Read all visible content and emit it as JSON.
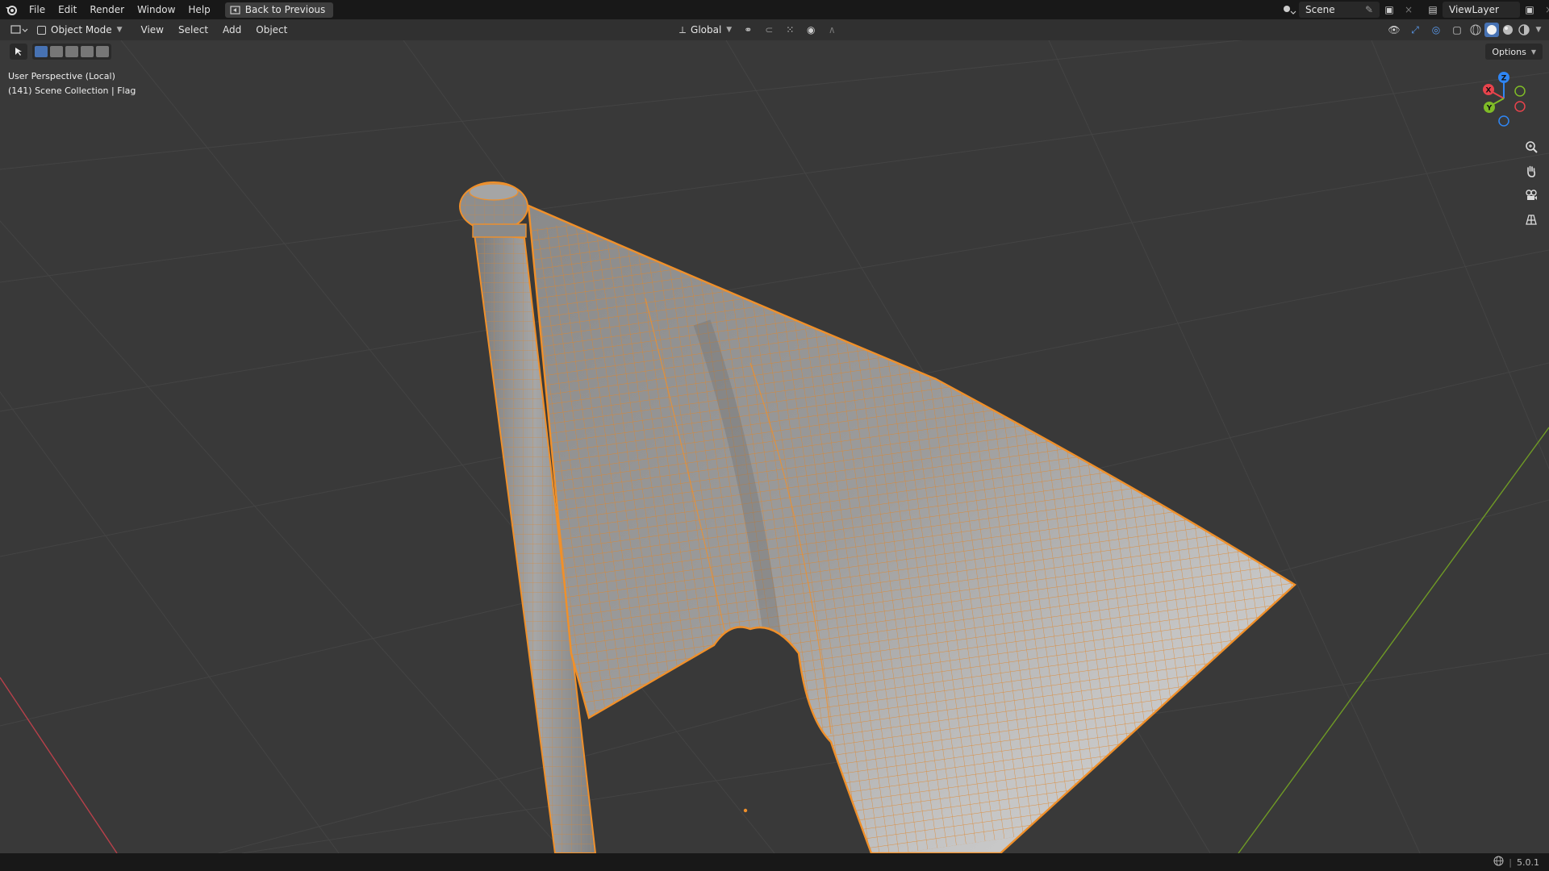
{
  "topbar": {
    "menu": [
      "File",
      "Edit",
      "Render",
      "Window",
      "Help"
    ],
    "back_label": "Back to Previous",
    "scene_name": "Scene",
    "view_layer": "ViewLayer"
  },
  "header": {
    "mode_label": "Object Mode",
    "menus": [
      "View",
      "Select",
      "Add",
      "Object"
    ],
    "orientation_label": "Global"
  },
  "viewport": {
    "perspective_label": "User Perspective (Local)",
    "collection_label": "(141) Scene Collection | Flag",
    "options_label": "Options",
    "gizmo": {
      "x_label": "X",
      "y_label": "Y",
      "z_label": "Z"
    }
  },
  "statusbar": {
    "version": "5.0.1"
  },
  "colors": {
    "accent_orange": "#f0902a",
    "axis_red": "#e8434c",
    "axis_green": "#7fbb27",
    "axis_blue": "#2f86f4",
    "viewport_bg": "#393939"
  }
}
